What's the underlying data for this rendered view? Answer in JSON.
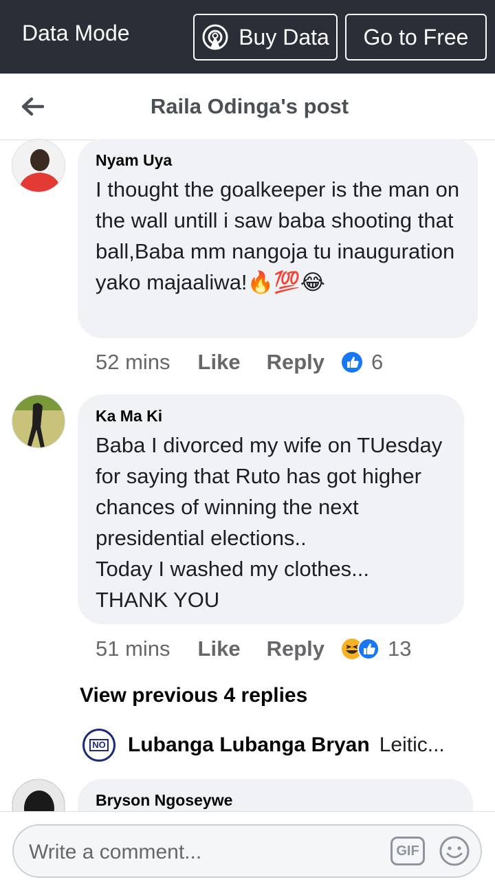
{
  "topbar": {
    "mode_label": "Data Mode",
    "buy_label": "Buy Data",
    "free_label": "Go to Free"
  },
  "header": {
    "title": "Raila Odinga's post"
  },
  "comments": [
    {
      "name": "Nyam Uya",
      "text": "I thought the goalkeeper is the man on the wall untill i saw baba shooting that ball,Baba mm nangoja tu inauguration yako majaaliwa!🔥💯😂",
      "time": "52 mins",
      "like": "Like",
      "reply": "Reply",
      "reactions": "6"
    },
    {
      "name": "Ka Ma Ki",
      "text": "Baba I divorced my wife on TUesday for saying that Ruto has got higher chances of winning the next presidential elections..\nToday I washed my clothes...\nTHANK YOU",
      "time": "51 mins",
      "like": "Like",
      "reply": "Reply",
      "reactions": "13"
    },
    {
      "name": "Bryson Ngoseywe"
    }
  ],
  "view_previous": "View previous 4 replies",
  "reply_preview": {
    "avatar_text": "NO",
    "name": "Lubanga Lubanga Bryan",
    "text": "Leitic..."
  },
  "composer": {
    "placeholder": "Write a comment...",
    "gif_label": "GIF"
  },
  "colors": {
    "topbar": "#2a2f37",
    "bubble": "#f0f2f5",
    "like_blue": "#1877f2"
  }
}
